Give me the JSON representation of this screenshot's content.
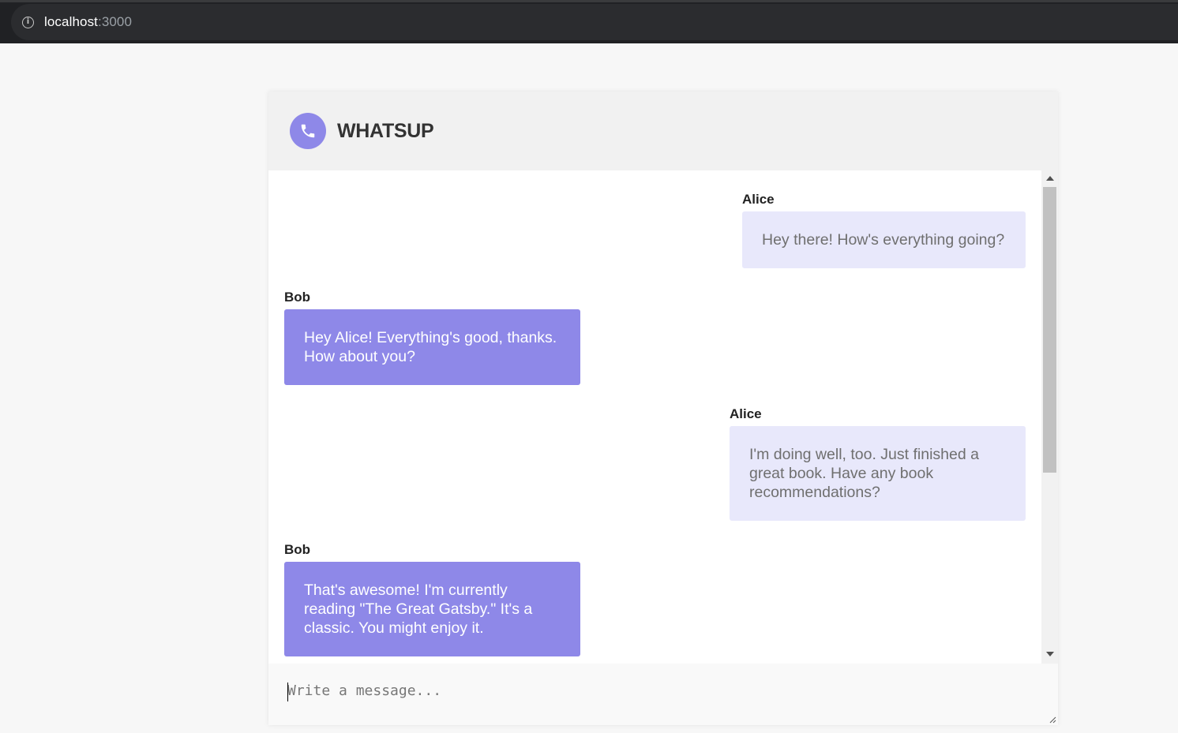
{
  "browser": {
    "url_host": "localhost",
    "url_port": ":3000"
  },
  "app": {
    "title": "WHATSUP",
    "logo_icon": "phone-icon",
    "accent_color": "#8e88e8",
    "incoming_bubble_color": "#e8e8fb"
  },
  "messages": [
    {
      "sender": "Alice",
      "text": "Hey there! How's everything going?",
      "side": "right"
    },
    {
      "sender": "Bob",
      "text": "Hey Alice! Everything's good, thanks. How about you?",
      "side": "left"
    },
    {
      "sender": "Alice",
      "text": "I'm doing well, too. Just finished a great book. Have any book recommendations?",
      "side": "right"
    },
    {
      "sender": "Bob",
      "text": "That's awesome! I'm currently reading \"The Great Gatsby.\" It's a classic. You might enjoy it.",
      "side": "left"
    }
  ],
  "composer": {
    "placeholder": "Write a message...",
    "value": ""
  }
}
